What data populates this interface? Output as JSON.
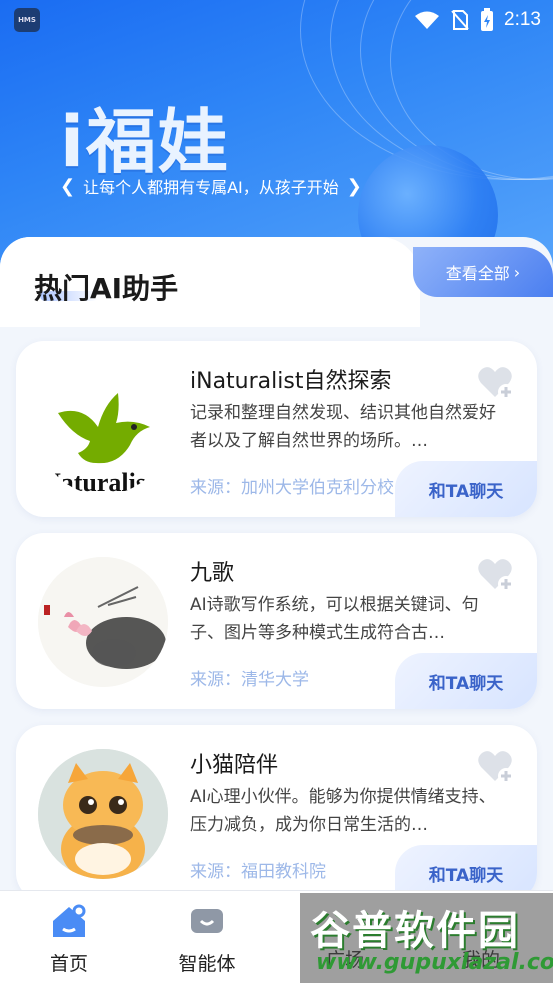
{
  "status": {
    "badge": "HMS",
    "time": "2:13"
  },
  "hero": {
    "brand": "i福娃",
    "slogan": "让每个人都拥有专属AI，从孩子开始"
  },
  "section": {
    "title": "热门AI助手",
    "view_all": "查看全部"
  },
  "cards": [
    {
      "name": "iNaturalist自然探索",
      "desc": "记录和整理自然发现、结识其他自然爱好者以及了解自然世界的场所。…",
      "source": "来源：加州大学伯克利分校 ...",
      "chat": "和TA聊天",
      "avatar_text": "Naturalis"
    },
    {
      "name": "九歌",
      "desc": "AI诗歌写作系统，可以根据关键词、句子、图片等多种模式生成符合古…",
      "source": "来源：清华大学",
      "chat": "和TA聊天"
    },
    {
      "name": "小猫陪伴",
      "desc": "AI心理小伙伴。能够为你提供情绪支持、压力减负，成为你日常生活的…",
      "source": "来源：福田教科院",
      "chat": "和TA聊天"
    }
  ],
  "nav": [
    {
      "label": "首页",
      "icon": "home-icon"
    },
    {
      "label": "智能体",
      "icon": "agent-icon"
    },
    {
      "label": "广场",
      "icon": "square-icon"
    },
    {
      "label": "我的",
      "icon": "profile-icon"
    }
  ],
  "watermark": {
    "title": "谷普软件园",
    "url": "www.gupuxlazal.com"
  },
  "colors": {
    "primary": "#1a6cf2",
    "accent": "#3a63c9",
    "source": "#9db8e8"
  }
}
